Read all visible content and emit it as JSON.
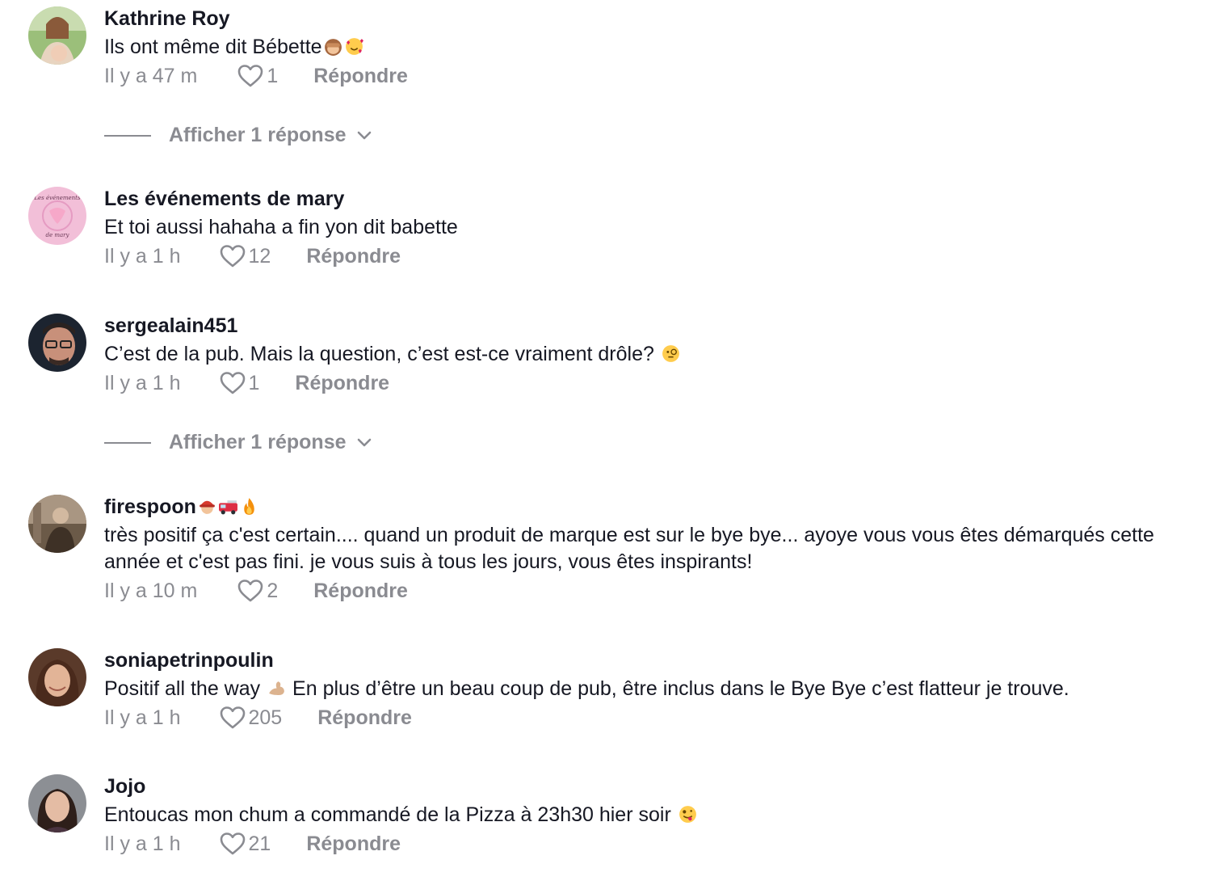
{
  "colors": {
    "text_primary": "#161823",
    "text_secondary": "#8a8b91"
  },
  "comments": [
    {
      "username": "Kathrine Roy",
      "emojis_after_name": [],
      "text": "Ils ont même dit Bébette",
      "text_emojis": [
        "see-no-evil-monkey",
        "smiling-face-with-hearts"
      ],
      "time": "Il y a 47 m",
      "likes": "1",
      "reply_label": "Répondre",
      "show_replies": "Afficher 1 réponse"
    },
    {
      "username": "Les événements de mary",
      "emojis_after_name": [],
      "text": "Et toi aussi hahaha a fin yon dit babette",
      "text_emojis": [],
      "time": "Il y a 1 h",
      "likes": "12",
      "reply_label": "Répondre"
    },
    {
      "username": "sergealain451",
      "emojis_after_name": [],
      "text": "C’est de la pub. Mais la question, c’est est-ce vraiment drôle?",
      "text_emojis": [
        "face-with-monocle"
      ],
      "time": "Il y a 1 h",
      "likes": "1",
      "reply_label": "Répondre",
      "show_replies": "Afficher 1 réponse"
    },
    {
      "username": "firespoon",
      "emojis_after_name": [
        "firefighter",
        "fire-engine",
        "fire"
      ],
      "text": "très positif ça c'est certain.... quand un produit de marque est sur le bye bye... ayoye vous vous êtes démarqués cette année et c'est pas fini. je vous suis à tous les jours, vous êtes inspirants!",
      "text_emojis": [],
      "time": "Il y a 10 m",
      "likes": "2",
      "reply_label": "Répondre"
    },
    {
      "username": "soniapetrinpoulin",
      "emojis_after_name": [],
      "text": "Positif all the way",
      "text_emojis": [
        "flexed-biceps"
      ],
      "text_after_emoji": " En plus d’être un beau coup de pub, être inclus dans le Bye Bye c’est flatteur je trouve.",
      "time": "Il y a 1 h",
      "likes": "205",
      "reply_label": "Répondre"
    },
    {
      "username": "Jojo",
      "emojis_after_name": [],
      "text": "Entoucas mon chum a commandé de la Pizza à 23h30 hier soir",
      "text_emojis": [
        "zany-face"
      ],
      "time": "Il y a 1 h",
      "likes": "21",
      "reply_label": "Répondre"
    }
  ]
}
